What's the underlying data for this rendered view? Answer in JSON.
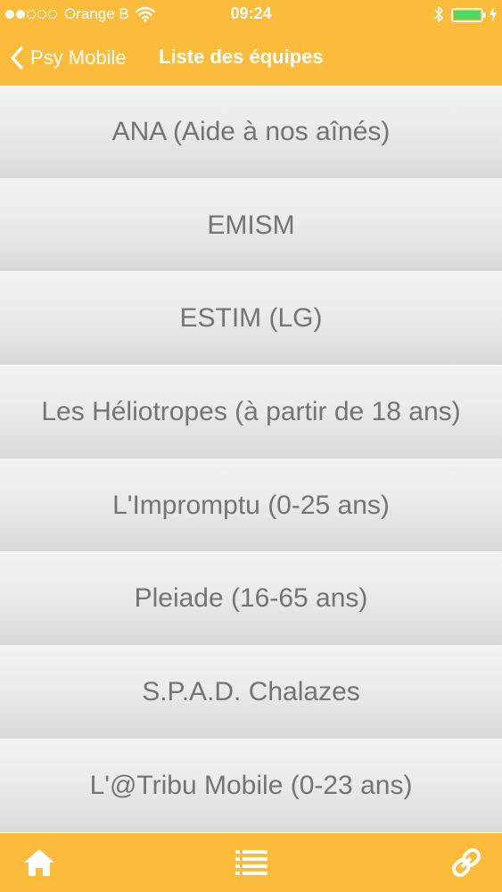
{
  "status_bar": {
    "carrier": "Orange B",
    "time": "09:24"
  },
  "nav": {
    "back_label": "Psy Mobile",
    "title": "Liste des équipes"
  },
  "teams": [
    {
      "label": "ANA (Aide à nos aînés)"
    },
    {
      "label": "EMISM"
    },
    {
      "label": "ESTIM (LG)"
    },
    {
      "label": "Les Héliotropes (à partir de 18 ans)"
    },
    {
      "label": "L'Impromptu (0-25 ans)"
    },
    {
      "label": "Pleiade (16-65 ans)"
    },
    {
      "label": "S.P.A.D. Chalazes"
    },
    {
      "label": "L'@Tribu Mobile (0-23 ans)"
    }
  ],
  "tab_bar": {
    "icons": [
      "home-icon",
      "list-icon",
      "link-icon"
    ]
  },
  "colors": {
    "accent": "#fbbb3b",
    "item_text": "#747474",
    "item_bg_top": "#f2f2f2",
    "item_bg_bottom": "#d9d9d9"
  }
}
